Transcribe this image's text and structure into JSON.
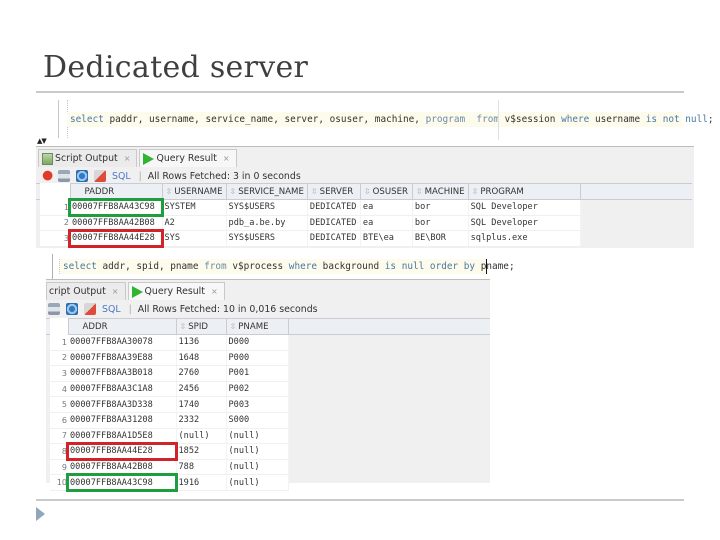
{
  "slide": {
    "title": "Dedicated server"
  },
  "query1": {
    "sql_parts": [
      {
        "t": "select",
        "c": "kw"
      },
      {
        "t": " paddr, username, service_name, server, osuser, machine, ",
        "c": ""
      },
      {
        "t": "program",
        "c": "kw2"
      },
      {
        "t": "  ",
        "c": ""
      },
      {
        "t": "from",
        "c": "kw2"
      },
      {
        "t": " v$session ",
        "c": ""
      },
      {
        "t": "where",
        "c": "kw"
      },
      {
        "t": " username ",
        "c": ""
      },
      {
        "t": "is not null",
        "c": "kw"
      },
      {
        "t": ";",
        "c": ""
      }
    ],
    "tabs": [
      {
        "label": "Script Output",
        "icon": "script-output-icon",
        "close": "×"
      },
      {
        "label": "Query Result",
        "icon": "run-icon",
        "close": "×"
      }
    ],
    "toolbar": {
      "sql_label": "SQL",
      "status": "All Rows Fetched: 3 in 0 seconds"
    },
    "columns": [
      "PADDR",
      "USERNAME",
      "SERVICE_NAME",
      "SERVER",
      "OSUSER",
      "MACHINE",
      "PROGRAM"
    ],
    "rows": [
      {
        "n": "1",
        "cells": [
          "00007FFB8AA43C98",
          "SYSTEM",
          "SYS$USERS",
          "DEDICATED",
          "ea",
          "bor",
          "SQL Developer"
        ],
        "highlight": "green"
      },
      {
        "n": "2",
        "cells": [
          "00007FFB8AA42B08",
          "A2",
          "pdb_a.be.by",
          "DEDICATED",
          "ea",
          "bor",
          "SQL Developer"
        ],
        "highlight": ""
      },
      {
        "n": "3",
        "cells": [
          "00007FFB8AA44E28",
          "SYS",
          "SYS$USERS",
          "DEDICATED",
          "BTE\\ea",
          "BE\\BOR",
          "sqlplus.exe"
        ],
        "highlight": "red"
      }
    ]
  },
  "query2": {
    "sql_parts": [
      {
        "t": "select",
        "c": "kw"
      },
      {
        "t": " addr, spid, pname ",
        "c": ""
      },
      {
        "t": "from",
        "c": "kw2"
      },
      {
        "t": " v$process ",
        "c": ""
      },
      {
        "t": "where",
        "c": "kw"
      },
      {
        "t": " background ",
        "c": ""
      },
      {
        "t": "is null order by",
        "c": "kw"
      },
      {
        "t": " pname;",
        "c": ""
      }
    ],
    "tabs": [
      {
        "label": "cript Output",
        "icon": "",
        "close": "×"
      },
      {
        "label": "Query Result",
        "icon": "run-icon",
        "close": "×"
      }
    ],
    "toolbar": {
      "sql_label": "SQL",
      "status": "All Rows Fetched: 10 in 0,016 seconds"
    },
    "columns": [
      "ADDR",
      "SPID",
      "PNAME"
    ],
    "rows": [
      {
        "n": "1",
        "cells": [
          "00007FFB8AA30078",
          "1136",
          "D000"
        ],
        "highlight": ""
      },
      {
        "n": "2",
        "cells": [
          "00007FFB8AA39E88",
          "1648",
          "P000"
        ],
        "highlight": ""
      },
      {
        "n": "3",
        "cells": [
          "00007FFB8AA3B018",
          "2760",
          "P001"
        ],
        "highlight": ""
      },
      {
        "n": "4",
        "cells": [
          "00007FFB8AA3C1A8",
          "2456",
          "P002"
        ],
        "highlight": ""
      },
      {
        "n": "5",
        "cells": [
          "00007FFB8AA3D338",
          "1740",
          "P003"
        ],
        "highlight": ""
      },
      {
        "n": "6",
        "cells": [
          "00007FFB8AA31208",
          "2332",
          "S000"
        ],
        "highlight": ""
      },
      {
        "n": "7",
        "cells": [
          "00007FFB8AA1D5E8",
          "(null)",
          "(null)"
        ],
        "highlight": ""
      },
      {
        "n": "8",
        "cells": [
          "00007FFB8AA44E28",
          "1852",
          "(null)"
        ],
        "highlight": "red"
      },
      {
        "n": "9",
        "cells": [
          "00007FFB8AA42B08",
          "788",
          "(null)"
        ],
        "highlight": ""
      },
      {
        "n": "10",
        "cells": [
          "00007FFB8AA43C98",
          "1916",
          "(null)"
        ],
        "highlight": "green"
      }
    ]
  },
  "colors": {
    "highlight_green": "#1e9e3e",
    "highlight_red": "#d2232a",
    "run_icon": "#32b432"
  }
}
